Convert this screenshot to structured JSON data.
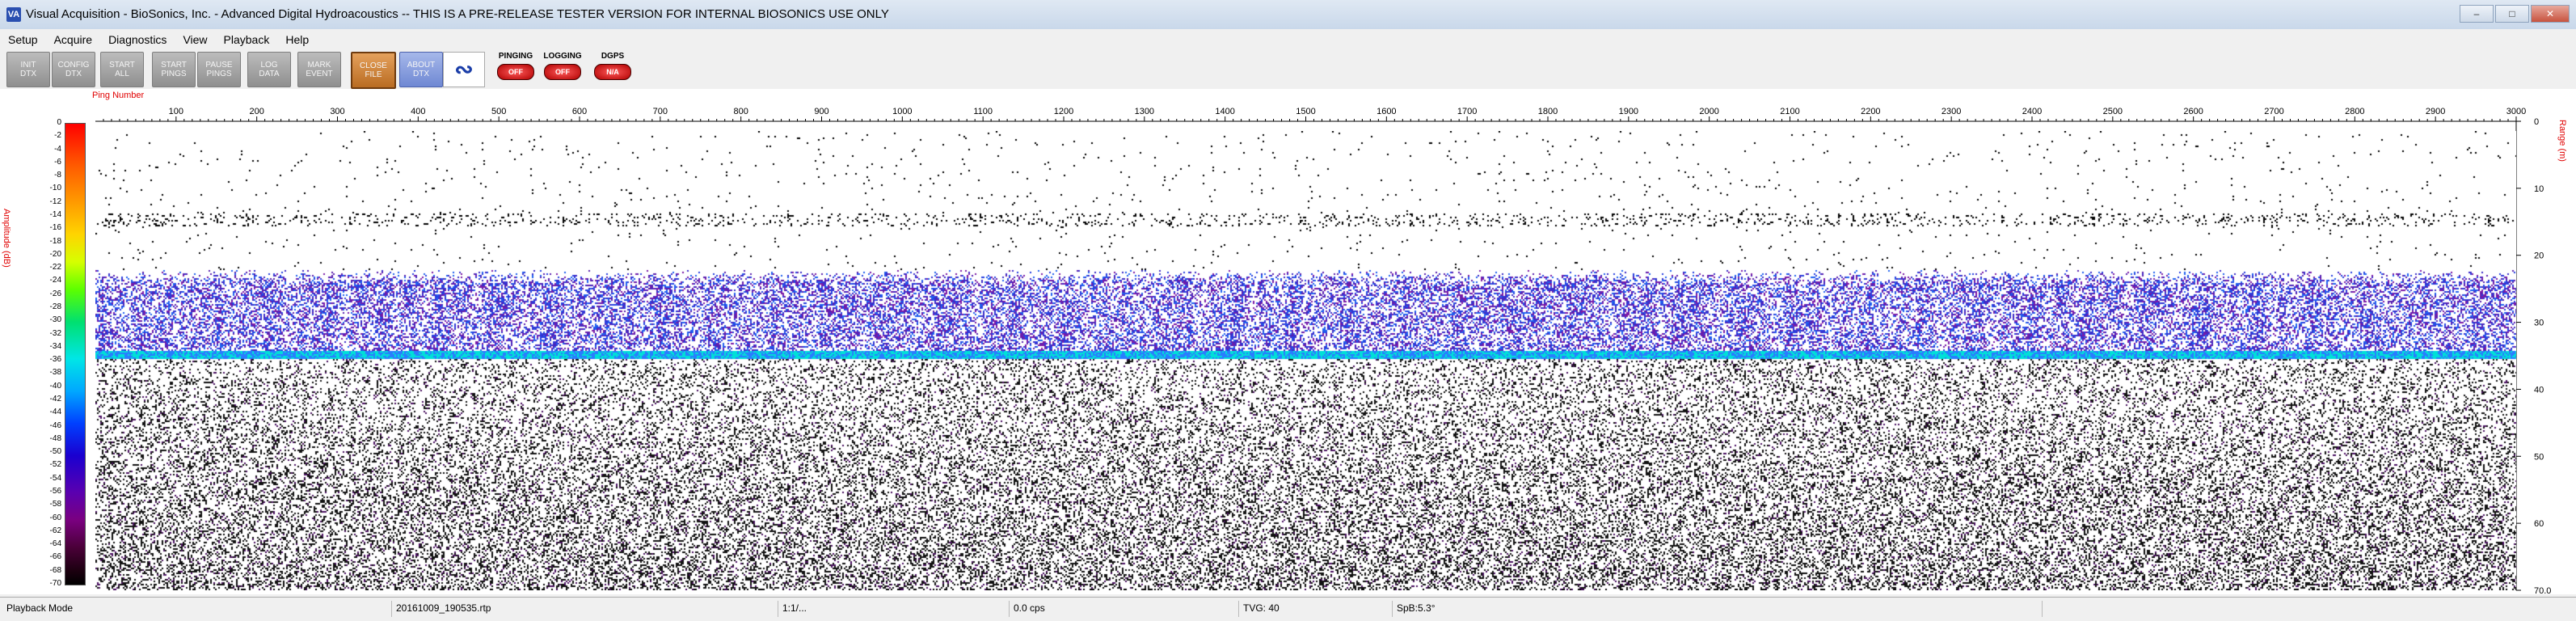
{
  "window": {
    "title": "Visual Acquisition - BioSonics, Inc. - Advanced Digital Hydroacoustics -- THIS IS A PRE-RELEASE TESTER VERSION FOR INTERNAL BIOSONICS USE ONLY",
    "icon_text": "VA"
  },
  "menu": [
    "Setup",
    "Acquire",
    "Diagnostics",
    "View",
    "Playback",
    "Help"
  ],
  "toolbar": {
    "buttons": [
      {
        "line1": "INIT",
        "line2": "DTX"
      },
      {
        "line1": "CONFIG",
        "line2": "DTX"
      },
      {
        "line1": "START",
        "line2": "ALL"
      },
      {
        "line1": "START",
        "line2": "PINGS"
      },
      {
        "line1": "PAUSE",
        "line2": "PINGS"
      },
      {
        "line1": "LOG",
        "line2": "DATA"
      },
      {
        "line1": "MARK",
        "line2": "EVENT"
      },
      {
        "line1": "CLOSE",
        "line2": "FILE"
      },
      {
        "line1": "ABOUT",
        "line2": "DTX"
      }
    ],
    "status": [
      {
        "label": "PINGING",
        "value": "OFF"
      },
      {
        "label": "LOGGING",
        "value": "OFF"
      },
      {
        "label": "DGPS",
        "value": "N/A"
      }
    ]
  },
  "display": {
    "ping_axis_label": "Ping Number",
    "amplitude_label": "Amplitude (dB)",
    "range_label": "Range (m)",
    "ping_ticks": [
      "100",
      "200",
      "300",
      "400",
      "500",
      "600",
      "700",
      "800",
      "900",
      "1000",
      "1100",
      "1200",
      "1300",
      "1400",
      "1500",
      "1600",
      "1700",
      "1800",
      "1900",
      "2000",
      "2100",
      "2200",
      "2300",
      "2400",
      "2500",
      "2600",
      "2700",
      "2800",
      "2900",
      "3000"
    ],
    "range_ticks": [
      "0",
      "10",
      "20",
      "30",
      "40",
      "50",
      "60",
      "70.0"
    ],
    "amplitude_ticks": [
      "0",
      "-2",
      "-4",
      "-6",
      "-8",
      "-10",
      "-12",
      "-14",
      "-16",
      "-18",
      "-20",
      "-22",
      "-24",
      "-26",
      "-28",
      "-30",
      "-32",
      "-34",
      "-36",
      "-38",
      "-40",
      "-42",
      "-44",
      "-46",
      "-48",
      "-50",
      "-52",
      "-54",
      "-56",
      "-58",
      "-60",
      "-62",
      "-64",
      "-66",
      "-68",
      "-70"
    ],
    "ping_range": [
      0,
      3000
    ],
    "range_m": [
      0,
      70
    ]
  },
  "statusbar": {
    "mode": "Playback Mode",
    "file": "20161009_190535.rtp",
    "ratio": "1:1/...",
    "rate": "0.0 cps",
    "tvg": "TVG: 40",
    "spb": "SpB:5.3°"
  }
}
